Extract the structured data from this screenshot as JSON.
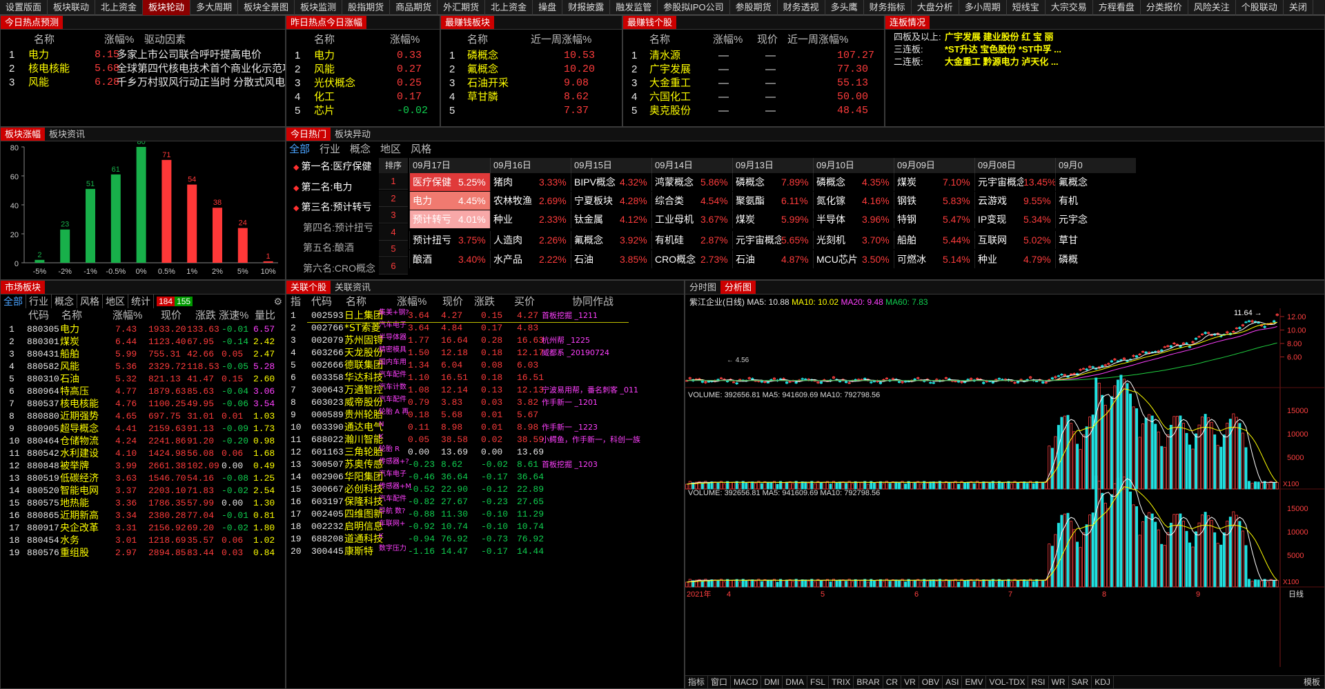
{
  "nav": [
    "设置版面",
    "板块联动",
    "北上资金",
    "板块轮动",
    "多大周期",
    "板块全景图",
    "板块监测",
    "股指期货",
    "商品期货",
    "外汇期货",
    "北上资金",
    "操盘",
    "财报披露",
    "融发监管",
    "参股拟IPO公司",
    "参股期货",
    "财务透视",
    "多头鹰",
    "财务指标",
    "大盘分析",
    "多小周期",
    "短线宝",
    "大宗交易",
    "方程看盘",
    "分类报价",
    "风险关注",
    "个股联动",
    "关闭"
  ],
  "forecast": {
    "title": "今日热点预测",
    "headers": [
      "名称",
      "涨幅%",
      "驱动因素"
    ],
    "rows": [
      [
        "1",
        "电力",
        "8.15",
        "多家上市公司联合呼吁提高电价"
      ],
      [
        "2",
        "核电核能",
        "5.68",
        "全球第四代核电技术首个商业化示范项目开"
      ],
      [
        "3",
        "风能",
        "6.28",
        "千乡万村驭风行动正当时 分散式风电迎来抢装"
      ]
    ]
  },
  "yesterday": {
    "title": "昨日热点今日涨幅",
    "headers": [
      "名称",
      "涨幅%"
    ],
    "rows": [
      [
        "1",
        "电力",
        "0.33"
      ],
      [
        "2",
        "风能",
        "0.27"
      ],
      [
        "3",
        "光伏概念",
        "0.25"
      ],
      [
        "4",
        "化工",
        "0.17"
      ],
      [
        "5",
        "芯片",
        "-0.02"
      ]
    ]
  },
  "moneyBoard": {
    "title": "最赚钱板块",
    "headers": [
      "名称",
      "近一周涨幅%"
    ],
    "rows": [
      [
        "1",
        "磷概念",
        "10.53"
      ],
      [
        "2",
        "氟概念",
        "10.20"
      ],
      [
        "3",
        "石油开采",
        "9.08"
      ],
      [
        "4",
        "草甘膦",
        "8.62"
      ],
      [
        "5",
        "",
        "7.37"
      ]
    ]
  },
  "moneyStock": {
    "title": "最赚钱个股",
    "headers": [
      "名称",
      "涨幅%",
      "现价",
      "近一周涨幅%"
    ],
    "rows": [
      [
        "1",
        "清水源",
        "—",
        "—",
        "107.27"
      ],
      [
        "2",
        "广宇发展",
        "—",
        "—",
        "77.30"
      ],
      [
        "3",
        "大金重工",
        "—",
        "—",
        "55.13"
      ],
      [
        "4",
        "六国化工",
        "—",
        "—",
        "50.00"
      ],
      [
        "5",
        "奥克股份",
        "—",
        "—",
        "48.45"
      ]
    ]
  },
  "lianban": {
    "title": "连板情况",
    "rows": [
      {
        "label": "四板及以上:",
        "names": "广宇发展  建业股份  红 宝 丽"
      },
      {
        "label": "三连板:",
        "names": "*ST升达  宝色股份  *ST中孚  ..."
      },
      {
        "label": "二连板:",
        "names": "大金重工  黔源电力  泸天化  ..."
      }
    ]
  },
  "boardRise": {
    "tabs": [
      "板块涨幅",
      "板块资讯"
    ]
  },
  "chart_data": {
    "type": "bar",
    "categories": [
      "-5%",
      "-2%",
      "-1%",
      "-0.5%",
      "0%",
      "0.5%",
      "1%",
      "2%",
      "5%",
      "10%"
    ],
    "values": [
      2,
      23,
      51,
      61,
      80,
      71,
      54,
      38,
      24,
      1
    ],
    "ylim": [
      0,
      80
    ],
    "yticks": [
      0,
      20,
      40,
      60,
      80
    ]
  },
  "todayHot": {
    "tabs": [
      "今日热门",
      "板块异动"
    ],
    "subtabs": [
      "全部",
      "行业",
      "概念",
      "地区",
      "风格"
    ],
    "ranks": [
      "第一名:医疗保健",
      "第二名:电力",
      "第三名:预计转亏",
      "第四名:预计扭亏",
      "第五名:酿酒",
      "第六名:CRO概念"
    ],
    "rankLabel": "排序",
    "rankNums": [
      "1",
      "2",
      "3",
      "4",
      "5",
      "6"
    ],
    "dates": [
      "09月17日",
      "09月16日",
      "09月15日",
      "09月14日",
      "09月13日",
      "09月10日",
      "09月09日",
      "09月08日",
      "09月0"
    ],
    "grid": [
      [
        [
          "医疗保健",
          "5.25%"
        ],
        [
          "猪肉",
          "3.33%"
        ],
        [
          "BIPV概念",
          "4.32%"
        ],
        [
          "鸿蒙概念",
          "5.86%"
        ],
        [
          "磷概念",
          "7.89%"
        ],
        [
          "磷概念",
          "4.35%"
        ],
        [
          "煤炭",
          "7.10%"
        ],
        [
          "元宇宙概念",
          "13.45%"
        ],
        [
          "氟概念",
          ""
        ]
      ],
      [
        [
          "电力",
          "4.45%"
        ],
        [
          "农林牧渔",
          "2.69%"
        ],
        [
          "宁夏板块",
          "4.28%"
        ],
        [
          "综合类",
          "4.54%"
        ],
        [
          "聚氨酯",
          "6.11%"
        ],
        [
          "氮化镓",
          "4.16%"
        ],
        [
          "钢铁",
          "5.83%"
        ],
        [
          "云游戏",
          "9.55%"
        ],
        [
          "有机",
          ""
        ]
      ],
      [
        [
          "预计转亏",
          "4.01%"
        ],
        [
          "种业",
          "2.33%"
        ],
        [
          "钛金属",
          "4.12%"
        ],
        [
          "工业母机",
          "3.67%"
        ],
        [
          "煤炭",
          "5.99%"
        ],
        [
          "半导体",
          "3.96%"
        ],
        [
          "特钢",
          "5.47%"
        ],
        [
          "IP变现",
          "5.34%"
        ],
        [
          "元宇念",
          ""
        ]
      ],
      [
        [
          "预计扭亏",
          "3.75%"
        ],
        [
          "人造肉",
          "2.26%"
        ],
        [
          "氟概念",
          "3.92%"
        ],
        [
          "有机硅",
          "2.87%"
        ],
        [
          "元宇宙概念",
          "5.65%"
        ],
        [
          "光刻机",
          "3.70%"
        ],
        [
          "船舶",
          "5.44%"
        ],
        [
          "互联网",
          "5.02%"
        ],
        [
          "草甘",
          ""
        ]
      ],
      [
        [
          "酿酒",
          "3.40%"
        ],
        [
          "水产品",
          "2.22%"
        ],
        [
          "石油",
          "3.85%"
        ],
        [
          "CRO概念",
          "2.73%"
        ],
        [
          "石油",
          "4.87%"
        ],
        [
          "MCU芯片",
          "3.50%"
        ],
        [
          "可燃冰",
          "5.14%"
        ],
        [
          "种业",
          "4.79%"
        ],
        [
          "磷概",
          ""
        ]
      ]
    ]
  },
  "market": {
    "tabs": [
      "市场板块"
    ],
    "subtabs": [
      "全部",
      "行业",
      "概念",
      "风格",
      "地区",
      "统计"
    ],
    "upCount": "184",
    "downCount": "155",
    "headers": [
      "代码",
      "名称",
      "涨幅%",
      "现价",
      "涨跌",
      "涨速%",
      "量比"
    ],
    "rows": [
      [
        "1",
        "880305",
        "电力",
        "7.43",
        "1933.20",
        "133.63",
        "-0.01",
        "6.57"
      ],
      [
        "2",
        "880301",
        "煤炭",
        "6.44",
        "1123.40",
        "67.95",
        "-0.14",
        "2.42"
      ],
      [
        "3",
        "880431",
        "船舶",
        "5.99",
        "755.31",
        "42.66",
        "0.05",
        "2.47"
      ],
      [
        "4",
        "880582",
        "风能",
        "5.36",
        "2329.72",
        "118.53",
        "-0.05",
        "5.28"
      ],
      [
        "5",
        "880310",
        "石油",
        "5.32",
        "821.13",
        "41.47",
        "0.15",
        "2.60"
      ],
      [
        "6",
        "880964",
        "特高压",
        "4.77",
        "1879.63",
        "85.63",
        "-0.04",
        "3.06"
      ],
      [
        "7",
        "880537",
        "核电核能",
        "4.76",
        "1100.25",
        "49.95",
        "-0.06",
        "3.54"
      ],
      [
        "8",
        "880880",
        "近期强势",
        "4.65",
        "697.75",
        "31.01",
        "0.01",
        "1.03"
      ],
      [
        "9",
        "880905",
        "超导概念",
        "4.41",
        "2159.63",
        "91.13",
        "-0.09",
        "1.73"
      ],
      [
        "10",
        "880464",
        "仓储物流",
        "4.24",
        "2241.86",
        "91.20",
        "-0.20",
        "0.98"
      ],
      [
        "11",
        "880542",
        "水利建设",
        "4.10",
        "1424.98",
        "56.08",
        "0.06",
        "1.68"
      ],
      [
        "12",
        "880848",
        "被举牌",
        "3.99",
        "2661.38",
        "102.09",
        "0.00",
        "0.49"
      ],
      [
        "13",
        "880519",
        "低碳经济",
        "3.63",
        "1546.70",
        "54.16",
        "-0.08",
        "1.25"
      ],
      [
        "14",
        "880520",
        "智能电网",
        "3.37",
        "2203.10",
        "71.83",
        "-0.02",
        "2.54"
      ],
      [
        "15",
        "880575",
        "地热能",
        "3.36",
        "1786.35",
        "57.99",
        "0.00",
        "1.30"
      ],
      [
        "16",
        "880865",
        "近期新高",
        "3.34",
        "2380.28",
        "77.04",
        "-0.01",
        "0.81"
      ],
      [
        "17",
        "880917",
        "央企改革",
        "3.31",
        "2156.92",
        "69.20",
        "-0.02",
        "1.80"
      ],
      [
        "18",
        "880454",
        "水务",
        "3.01",
        "1218.69",
        "35.57",
        "0.06",
        "1.02"
      ],
      [
        "19",
        "880576",
        "重组股",
        "2.97",
        "2894.85",
        "83.44",
        "0.03",
        "0.84"
      ]
    ]
  },
  "related": {
    "tabs": [
      "关联个股",
      "关联资讯"
    ],
    "headers": [
      "指",
      "代码",
      "名称",
      "涨幅%",
      "现价",
      "涨跌",
      "买价",
      "协同作战"
    ],
    "rows": [
      [
        "1",
        "002593",
        "日上集团",
        "集美+钢?",
        "3.64",
        "4.27",
        "0.15",
        "4.27",
        "首板挖掘 _1211"
      ],
      [
        "2",
        "002766",
        "*ST索菱",
        "汽车电子",
        "3.64",
        "4.84",
        "0.17",
        "4.83",
        ""
      ],
      [
        "3",
        "002079",
        "苏州固锝",
        "半导体器",
        "1.77",
        "16.64",
        "0.28",
        "16.63",
        "杭州帮 _1225"
      ],
      [
        "4",
        "603266",
        "天龙股份",
        "精密模具",
        "1.50",
        "12.18",
        "0.18",
        "12.17",
        "威都系 _20190724"
      ],
      [
        "5",
        "002666",
        "德联集团",
        "国内车用",
        "1.34",
        "6.04",
        "0.08",
        "6.03",
        ""
      ],
      [
        "6",
        "603358",
        "华达科技",
        "汽车配件",
        "1.10",
        "16.51",
        "0.18",
        "16.51",
        ""
      ],
      [
        "7",
        "300643",
        "万通智控",
        "汽车计数",
        "1.08",
        "12.14",
        "0.13",
        "12.13",
        "宁波易用帮，番名刺客 _011"
      ],
      [
        "8",
        "603023",
        "威帝股份",
        "汽车配件",
        "0.79",
        "3.83",
        "0.03",
        "3.82",
        "作手新一 _1201"
      ],
      [
        "9",
        "000589",
        "贵州轮胎",
        "轮胎 A 再",
        "0.18",
        "5.68",
        "0.01",
        "5.67",
        ""
      ],
      [
        "10",
        "603390",
        "通达电气",
        "N",
        "0.11",
        "8.98",
        "0.01",
        "8.98",
        "作手新一 _1223"
      ],
      [
        "11",
        "688022",
        "瀚川智能",
        "K",
        "0.05",
        "38.58",
        "0.02",
        "38.59",
        "小鳄鱼，作手新一，科创一族"
      ],
      [
        "12",
        "601163",
        "三角轮胎",
        "轮胎 R",
        "0.00",
        "13.69",
        "0.00",
        "13.69",
        ""
      ],
      [
        "13",
        "300507",
        "苏奥传感",
        "传感器+?",
        "-0.23",
        "8.62",
        "-0.02",
        "8.61",
        "首板挖掘 _1203"
      ],
      [
        "14",
        "002906",
        "华阳集团",
        "汽车电子",
        "-0.46",
        "36.64",
        "-0.17",
        "36.64",
        ""
      ],
      [
        "15",
        "300667",
        "必创科技",
        "传感器+M",
        "-0.52",
        "22.90",
        "-0.12",
        "22.89",
        ""
      ],
      [
        "16",
        "603197",
        "保隆科技",
        "汽车配件",
        "-0.82",
        "27.67",
        "-0.23",
        "27.65",
        ""
      ],
      [
        "17",
        "002405",
        "四维图新",
        "导航 数?",
        "-0.88",
        "11.30",
        "-0.10",
        "11.29",
        ""
      ],
      [
        "18",
        "002232",
        "启明信息",
        "车联网+",
        "-0.92",
        "10.74",
        "-0.10",
        "10.74",
        ""
      ],
      [
        "19",
        "688208",
        "道通科技",
        "K",
        "-0.94",
        "76.92",
        "-0.73",
        "76.92",
        ""
      ],
      [
        "20",
        "300445",
        "康斯特",
        "数字压力",
        "-1.16",
        "14.47",
        "-0.17",
        "14.44",
        ""
      ]
    ]
  },
  "analysis": {
    "tabs": [
      "分时图",
      "分析图"
    ],
    "stockTitle": "紫江企业(日线)",
    "ma": [
      "MA5: 10.88",
      "MA10: 10.02",
      "MA20: 9.48",
      "MA60: 7.83"
    ],
    "priceTicks": [
      "12.00",
      "10.00",
      "8.00",
      "6.00"
    ],
    "high": "11.64",
    "low": "4.56",
    "vol1": "VOLUME: 392656.81  MA5: 941609.69  MA10: 792798.56",
    "vol2": "VOLUME: 392656.81  MA5: 941609.69  MA10: 792798.56",
    "volTicks": [
      "15000",
      "10000",
      "5000"
    ],
    "x100": "X100",
    "year": "2021年",
    "months": [
      "4",
      "5",
      "6",
      "7",
      "8",
      "9"
    ],
    "period": "日线",
    "indicators": [
      "指标",
      "窗口",
      "MACD",
      "DMI",
      "DMA",
      "FSL",
      "TRIX",
      "BRAR",
      "CR",
      "VR",
      "OBV",
      "ASI",
      "EMV",
      "VOL-TDX",
      "RSI",
      "WR",
      "SAR",
      "KDJ"
    ],
    "template": "模板"
  }
}
